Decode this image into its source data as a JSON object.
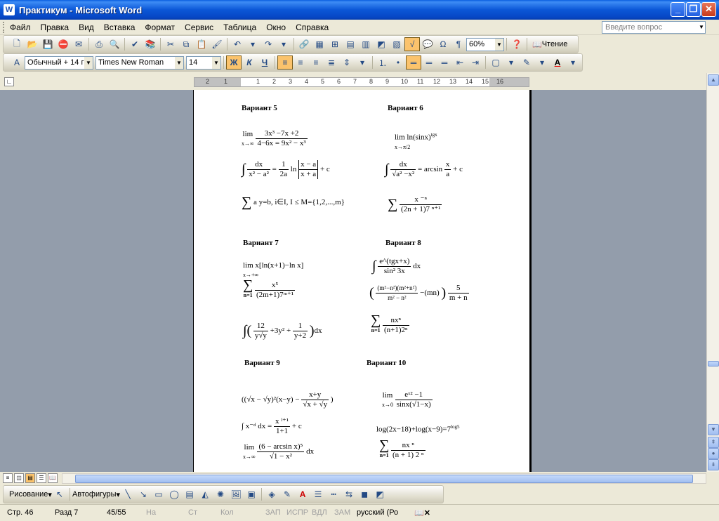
{
  "window": {
    "title": "Практикум - Microsoft Word",
    "icon": "W"
  },
  "menu": [
    "Файл",
    "Правка",
    "Вид",
    "Вставка",
    "Формат",
    "Сервис",
    "Таблица",
    "Окно",
    "Справка"
  ],
  "help_placeholder": "Введите вопрос",
  "standard_toolbar": {
    "zoom": "60%",
    "read_label": "Чтение"
  },
  "format_toolbar": {
    "style": "Обычный + 14 г",
    "font": "Times New Roman",
    "size": "14",
    "bold": "Ж",
    "italic": "К",
    "underline": "Ч"
  },
  "ruler_ticks": [
    "2",
    "1",
    "1",
    "2",
    "3",
    "4",
    "5",
    "6",
    "7",
    "8",
    "9",
    "10",
    "11",
    "12",
    "13",
    "14",
    "15",
    "16"
  ],
  "document": {
    "variants": [
      {
        "label": "Вариант 5"
      },
      {
        "label": "Вариант 6"
      },
      {
        "label": "Вариант 7"
      },
      {
        "label": "Вариант 8"
      },
      {
        "label": "Вариант 9"
      },
      {
        "label": "Вариант 10"
      }
    ],
    "formulas": {
      "v5_f1_lim": "lim",
      "v5_f1_sub": "x→∞",
      "v5_f1_num": "3x³ −7x +2",
      "v5_f1_den": "4−6x = 9x² − x³",
      "v5_f2_int": "∫",
      "v5_f2_num": "dx",
      "v5_f2_den": "x² − a²",
      "v5_f2_eq": "=",
      "v5_f2_c1": "1",
      "v5_f2_c2": "2a",
      "v5_f2_ln": "ln",
      "v5_f2_ab_num": "x − a",
      "v5_f2_ab_den": "x + a",
      "v5_f2_tail": "+ c",
      "v5_f3_sum": "∑",
      "v5_f3_body": "a y=b, i∈I, I ≤ M={1,2,...,m}",
      "v6_f1": "lim ln(sinx)",
      "v6_f1_sup": "tgx",
      "v6_f1_sub": "x→π/2",
      "v6_f2_num": "dx",
      "v6_f2_den": "√a² −x²",
      "v6_f2_eq": "= arcsin",
      "v6_f2_fnum": "x",
      "v6_f2_fden": "a",
      "v6_f2_tail": "+ c",
      "v6_f3_num": "x ⁻ⁿ",
      "v6_f3_den": "(2n + 1)7 ⁿ⁺¹",
      "v7_f1": "lim x[ln(x+1)−ln x]",
      "v7_f1_sub": "x→+∞",
      "v7_f2_num": "x⁵",
      "v7_f2_den": "(2m+1)7ᵐ⁺¹",
      "v7_f2_sub": "n=1",
      "v7_f3_a": "12",
      "v7_f3_ad": "y√y",
      "v7_f3_mid": "+3y² +",
      "v7_f3_b": "1",
      "v7_f3_bd": "y+2",
      "v7_f3_tail": "dx",
      "v8_f1_num": "e^(tgx+x)",
      "v8_f1_den": "sin² 3x",
      "v8_f1_tail": "dx",
      "v8_f2_num": "(m²−n²)(m²+n²)",
      "v8_f2_den": "m² − n²",
      "v8_f2_mid": "−(mn)",
      "v8_f2_fnum": "5",
      "v8_f2_fden": "m + n",
      "v8_f3_num": "nxⁿ",
      "v8_f3_den": "(n+1)2ⁿ",
      "v8_f3_sub": "n=1",
      "v9_f1": "((√x − √y)²(x−y) −",
      "v9_f1_fnum": "x+y",
      "v9_f1_fden": "√x + √y",
      "v9_f1_tail": ")",
      "v9_f2_int": "∫ x⁻ᵈ dx  =",
      "v9_f2_num": "x ˡ⁺¹",
      "v9_f2_den": "1+1",
      "v9_f2_tail": "+ c",
      "v9_f3_lim": "lim",
      "v9_f3_sub": "x→∞",
      "v9_f3_num": "(6 − arcsin   x)⁵",
      "v9_f3_den": "√1 − x²",
      "v9_f3_tail": "dx",
      "v10_f1_lim": "lim",
      "v10_f1_sub": "x→0",
      "v10_f1_num": "eˣ² −1",
      "v10_f1_den": "sinx(√1−x)",
      "v10_f2": "log(2x−18)+log(x−9)=7",
      "v10_f2_sup": "log5",
      "v10_f3_num": "nx ⁿ",
      "v10_f3_den": "(n + 1) 2 ⁿ",
      "v10_f3_sub": "n=1"
    }
  },
  "drawing_toolbar": {
    "draw": "Рисование",
    "autoshapes": "Автофигуры"
  },
  "status": {
    "page": "Стр. 46",
    "section": "Разд 7",
    "pages": "45/55",
    "at": "На",
    "line": "Ст",
    "col": "Кол",
    "rec": "ЗАП",
    "trk": "ИСПР",
    "ext": "ВДЛ",
    "ovr": "ЗАМ",
    "lang": "русский (Ро"
  }
}
